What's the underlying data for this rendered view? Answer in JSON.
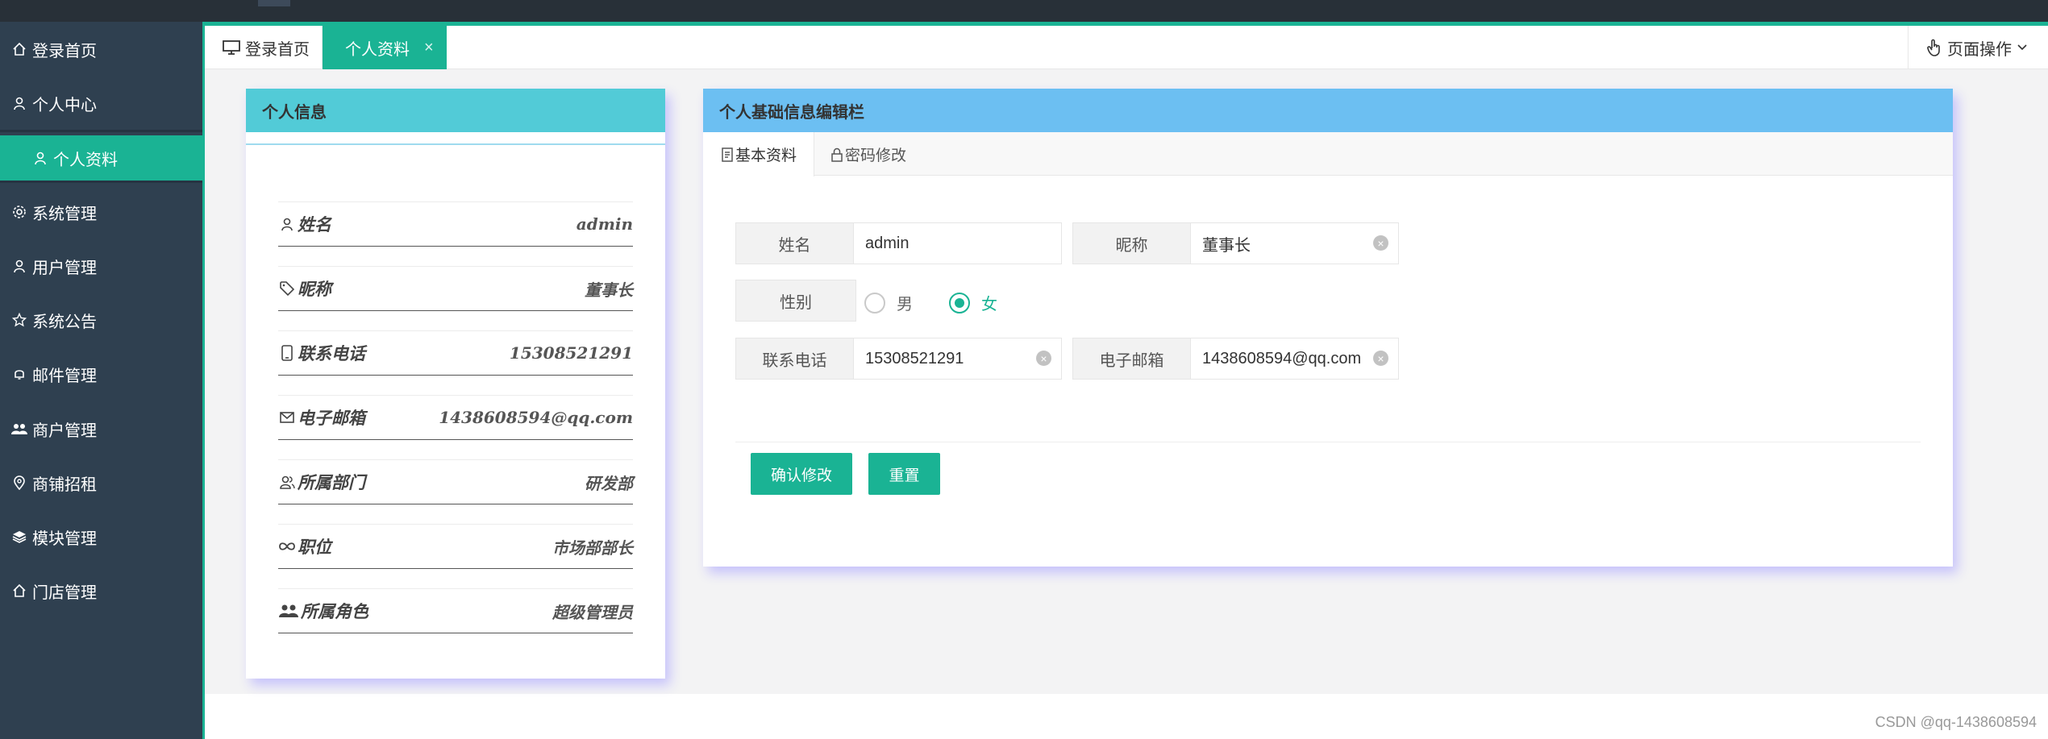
{
  "sidebar": {
    "items": [
      {
        "label": "登录首页",
        "icon": "home-icon"
      },
      {
        "label": "个人中心",
        "icon": "user-icon"
      },
      {
        "label": "个人资料",
        "icon": "user-icon",
        "active": true
      },
      {
        "label": "系统管理",
        "icon": "gear-icon"
      },
      {
        "label": "用户管理",
        "icon": "user-icon"
      },
      {
        "label": "系统公告",
        "icon": "star-icon"
      },
      {
        "label": "邮件管理",
        "icon": "bell-icon"
      },
      {
        "label": "商户管理",
        "icon": "users-icon"
      },
      {
        "label": "商铺招租",
        "icon": "location-icon"
      },
      {
        "label": "模块管理",
        "icon": "layers-icon"
      },
      {
        "label": "门店管理",
        "icon": "home-icon"
      }
    ]
  },
  "tabs": {
    "home_label": "登录首页",
    "profile_label": "个人资料",
    "close_symbol": "×",
    "page_ops_label": "页面操作"
  },
  "info_card": {
    "title": "个人信息",
    "rows": [
      {
        "label": "姓名",
        "value": "admin",
        "icon": "user-icon"
      },
      {
        "label": "昵称",
        "value": "董事长",
        "icon": "tag-icon"
      },
      {
        "label": "联系电话",
        "value": "15308521291",
        "icon": "mobile-icon"
      },
      {
        "label": "电子邮箱",
        "value": "1438608594@qq.com",
        "icon": "mail-icon"
      },
      {
        "label": "所属部门",
        "value": "研发部",
        "icon": "user-group-icon"
      },
      {
        "label": "职位",
        "value": "市场部部长",
        "icon": "infinity-icon"
      },
      {
        "label": "所属角色",
        "value": "超级管理员",
        "icon": "users-icon"
      }
    ]
  },
  "edit_card": {
    "title": "个人基础信息编辑栏",
    "tab_basic": "基本资料",
    "tab_password": "密码修改",
    "fields": {
      "name_label": "姓名",
      "name_value": "admin",
      "nickname_label": "昵称",
      "nickname_value": "董事长",
      "gender_label": "性别",
      "gender_male": "男",
      "gender_female": "女",
      "phone_label": "联系电话",
      "phone_value": "15308521291",
      "email_label": "电子邮箱",
      "email_value": "1438608594@qq.com"
    },
    "confirm_button": "确认修改",
    "reset_button": "重置"
  },
  "watermark": "CSDN @qq-1438608594",
  "colors": {
    "accent": "#1ab394",
    "sidebar": "#2f4050",
    "info_header": "#52cbd7",
    "edit_header": "#6cbff2"
  }
}
